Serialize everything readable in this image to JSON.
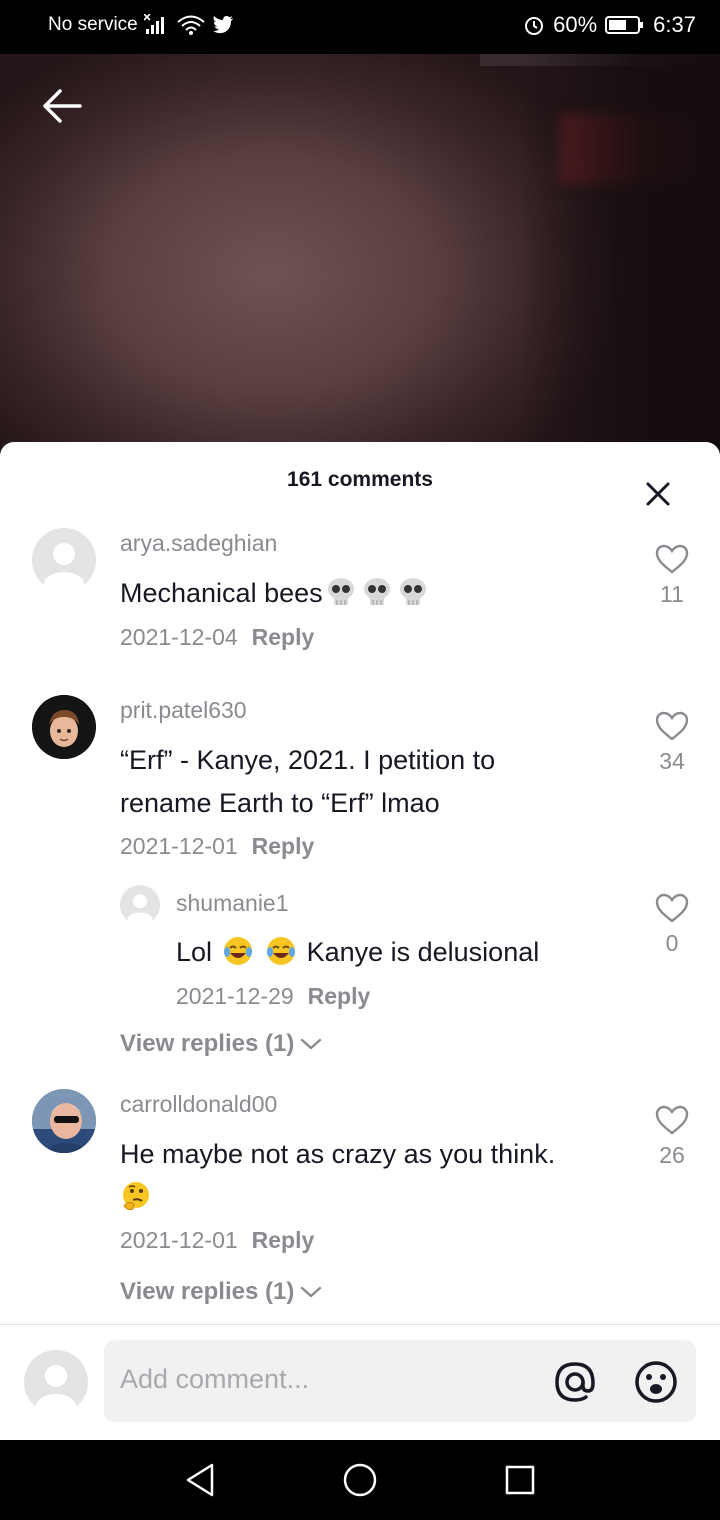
{
  "status_bar": {
    "carrier": "No service",
    "battery": "60%",
    "time": "6:37"
  },
  "sheet": {
    "title": "161 comments"
  },
  "comments": [
    {
      "username": "arya.sadeghian",
      "text": "Mechanical bees",
      "emojis": [
        "skull",
        "skull",
        "skull"
      ],
      "date": "2021-12-04",
      "reply_label": "Reply",
      "likes": "11"
    },
    {
      "username": "prit.patel630",
      "text_line1": "“Erf” - Kanye, 2021. I petition to",
      "text_line2": "rename Earth to “Erf” lmao",
      "date": "2021-12-01",
      "reply_label": "Reply",
      "likes": "34",
      "reply": {
        "username": "shumanie1",
        "text_pre": "Lol",
        "emojis": [
          "tears-of-joy",
          "tears-of-joy"
        ],
        "text_post": "Kanye is delusional",
        "date": "2021-12-29",
        "reply_label": "Reply",
        "likes": "0"
      },
      "view_replies": "View replies (1)"
    },
    {
      "username": "carrolldonald00",
      "text_line1": "He maybe not as crazy as you think.",
      "emojis": [
        "thinking-face"
      ],
      "date": "2021-12-01",
      "reply_label": "Reply",
      "likes": "26",
      "view_replies": "View replies (1)"
    }
  ],
  "composer": {
    "placeholder": "Add comment..."
  },
  "colors": {
    "text_primary": "#161823",
    "text_secondary": "#8a8b91",
    "input_bg": "#f1f1f2"
  }
}
